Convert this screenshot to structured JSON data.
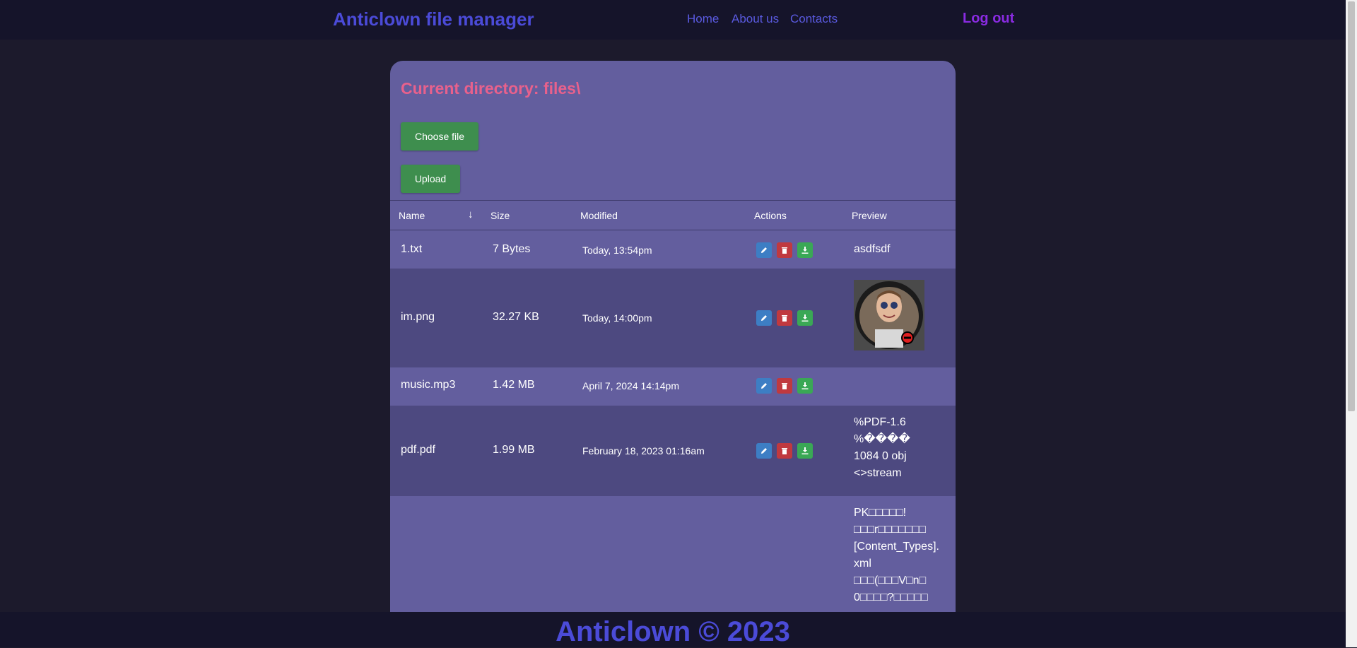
{
  "nav": {
    "brand": "Anticlown file manager",
    "links": [
      "Home",
      "About us",
      "Contacts"
    ],
    "logout": "Log out"
  },
  "panel": {
    "title": "Current directory: files\\",
    "choose_file": "Choose file",
    "upload": "Upload"
  },
  "table": {
    "headers": [
      "Name",
      "Size",
      "Modified",
      "Actions",
      "Preview"
    ],
    "sort_icon": "↓",
    "rows": [
      {
        "name": "1.txt",
        "size": "7 Bytes",
        "modified": "Today, 13:54pm",
        "preview": "asdfsdf"
      },
      {
        "name": "im.png",
        "size": "32.27 KB",
        "modified": "Today, 14:00pm",
        "preview": ""
      },
      {
        "name": "music.mp3",
        "size": "1.42 MB",
        "modified": "April 7, 2024 14:14pm",
        "preview": ""
      },
      {
        "name": "pdf.pdf",
        "size": "1.99 MB",
        "modified": "February 18, 2023 01:16am",
        "preview": "%PDF-1.6\n%����\n1084 0 obj\n<>stream"
      },
      {
        "name": "",
        "size": "",
        "modified": "",
        "preview": "PK□□□□□!\n□□□r□□□□□□□\n[Content_Types].\nxml\n□□□(□□□V□n□\n0□□□□?□□□□□"
      }
    ]
  },
  "icons": {
    "edit": "pencil-icon",
    "delete": "trash-icon",
    "download": "download-icon"
  },
  "colors": {
    "brand": "#4b4bd8",
    "logout": "#8a2be2",
    "title": "#e8618c",
    "button": "#3e8e4e",
    "edit": "#3d7ec4",
    "delete": "#c0393f",
    "download": "#3aa855"
  },
  "footer": {
    "text": "Anticlown © 2023"
  }
}
